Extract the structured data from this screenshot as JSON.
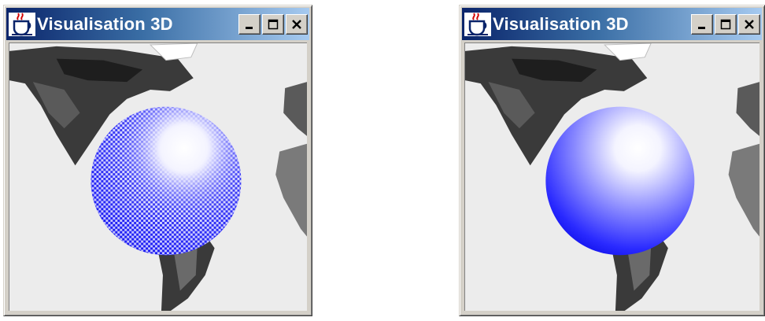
{
  "windows": [
    {
      "title": "Visualisation 3D",
      "icon": "java-cup-icon",
      "controls": [
        "minimize",
        "maximize",
        "close"
      ],
      "render_mode": "dithered"
    },
    {
      "title": "Visualisation 3D",
      "icon": "java-cup-icon",
      "controls": [
        "minimize",
        "maximize",
        "close"
      ],
      "render_mode": "smooth"
    }
  ],
  "colors": {
    "titlebar_start": "#0a246a",
    "titlebar_end": "#a6caf0",
    "sphere_blue": "#1010ff",
    "sphere_highlight": "#ffffff",
    "ocean": "#ececec",
    "land_dark": "#1e1e1e"
  }
}
